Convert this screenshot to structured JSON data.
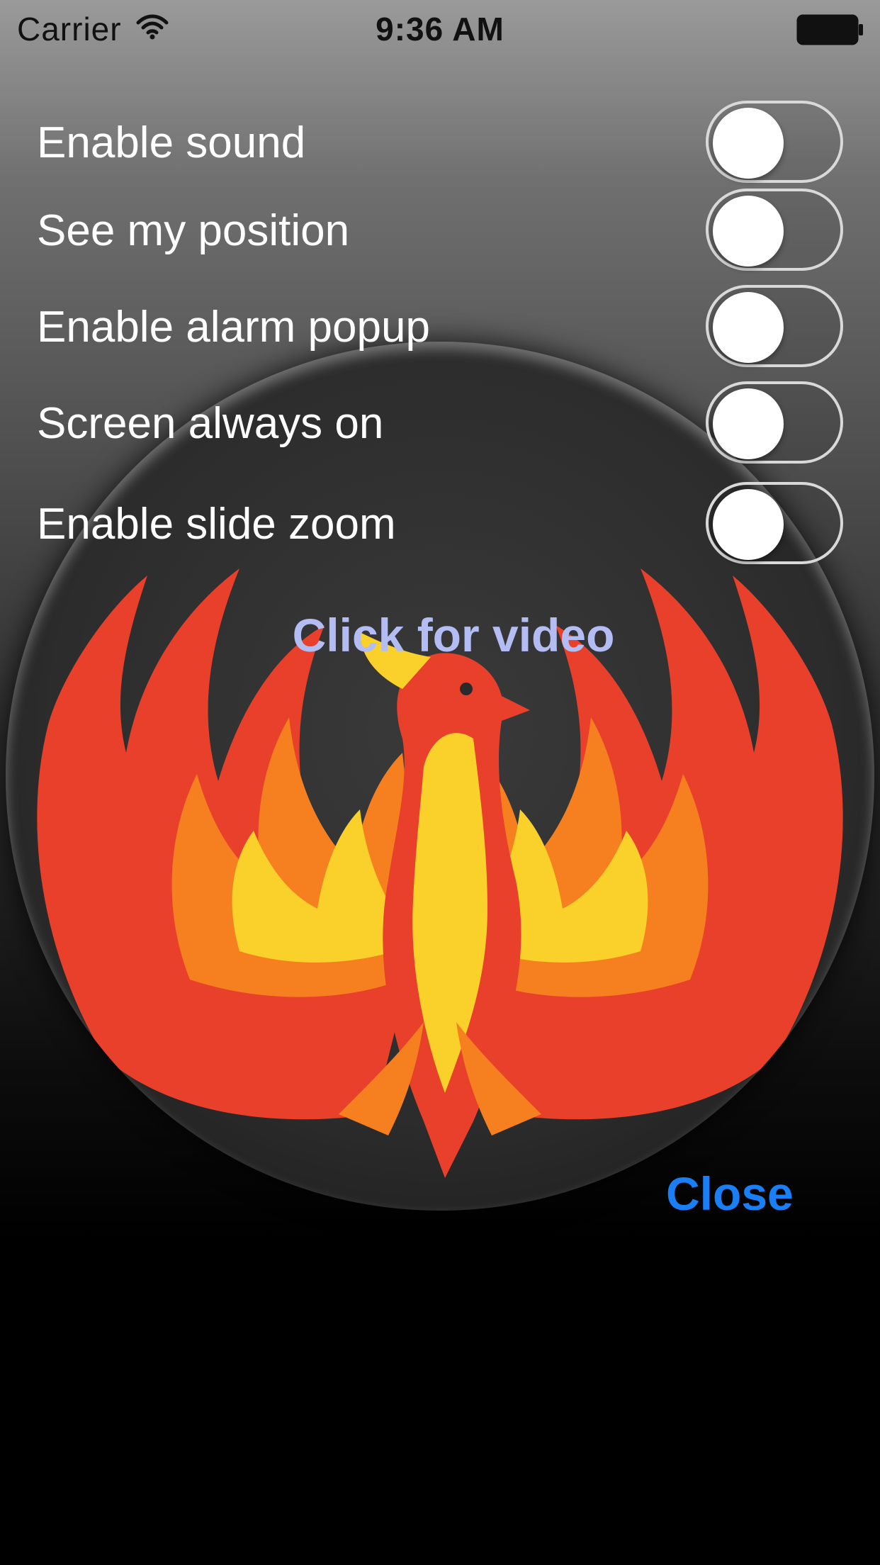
{
  "status_bar": {
    "carrier": "Carrier",
    "time": "9:36 AM",
    "wifi_icon": "wifi-icon",
    "battery_icon": "battery-icon"
  },
  "settings": [
    {
      "label": "Enable sound",
      "on": false
    },
    {
      "label": "See my position",
      "on": false
    },
    {
      "label": "Enable alarm popup",
      "on": false
    },
    {
      "label": "Screen always on",
      "on": false
    },
    {
      "label": "Enable slide zoom",
      "on": false
    }
  ],
  "video_link": "Click for video",
  "close_label": "Close",
  "logo": "phoenix-logo",
  "colors": {
    "link_blue": "#1a7ef5",
    "video_link": "#b3bdf4",
    "flame_red": "#e8402a",
    "flame_orange": "#f6801f",
    "flame_yellow": "#f9d12a"
  }
}
